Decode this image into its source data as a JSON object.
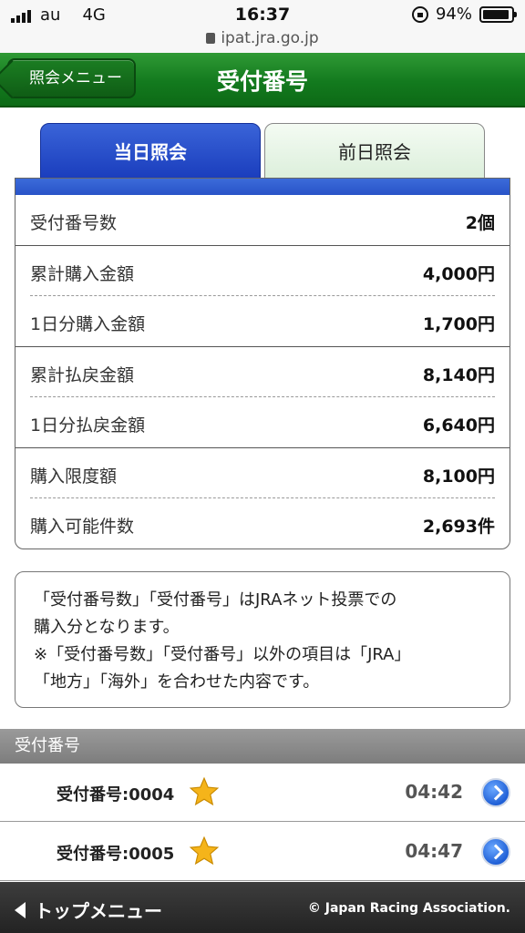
{
  "status_bar": {
    "carrier": "au",
    "network": "4G",
    "time": "16:37",
    "battery": "94%",
    "battery_level": 0.94
  },
  "url": "ipat.jra.go.jp",
  "header": {
    "back_label": "照会メニュー",
    "title": "受付番号"
  },
  "tabs": [
    {
      "label": "当日照会",
      "active": true
    },
    {
      "label": "前日照会",
      "active": false
    }
  ],
  "summary": {
    "rows": [
      {
        "label": "受付番号数",
        "value": "2個"
      },
      {
        "label": "累計購入金額",
        "value": "4,000円"
      },
      {
        "label": "1日分購入金額",
        "value": "1,700円"
      },
      {
        "label": "累計払戻金額",
        "value": "8,140円"
      },
      {
        "label": "1日分払戻金額",
        "value": "6,640円"
      },
      {
        "label": "購入限度額",
        "value": "8,100円"
      },
      {
        "label": "購入可能件数",
        "value": "2,693件"
      }
    ]
  },
  "notice": {
    "line1": "「受付番号数」「受付番号」はJRAネット投票での",
    "line2": "購入分となります。",
    "line3": "※「受付番号数」「受付番号」以外の項目は「JRA」",
    "line4": "「地方」「海外」を合わせた内容です。"
  },
  "section_title": "受付番号",
  "receipts": [
    {
      "label": "受付番号:0004",
      "time": "04:42"
    },
    {
      "label": "受付番号:0005",
      "time": "04:47"
    }
  ],
  "footer": {
    "top_menu": "トップメニュー",
    "copyright": "© Japan Racing Association."
  },
  "colors": {
    "header_green": "#137a1e",
    "tab_blue": "#1a3dbd",
    "star_gold": "#f5b41a"
  }
}
